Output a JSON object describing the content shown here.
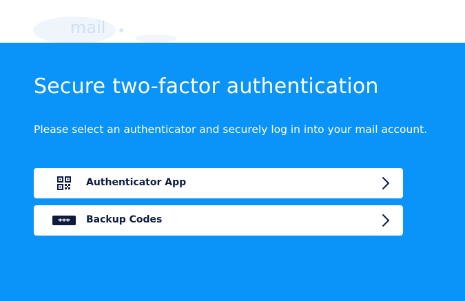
{
  "header": {
    "logo_text": "mail.de"
  },
  "main": {
    "title": "Secure two-factor authentication",
    "subtitle": "Please select an authenticator and securely log in into your mail account.",
    "options": [
      {
        "label": "Authenticator App",
        "icon": "qr-code-icon"
      },
      {
        "label": "Backup Codes",
        "icon": "password-dots-icon"
      }
    ]
  },
  "colors": {
    "background": "#0a93f8",
    "card": "#ffffff",
    "text_dark": "#0d1b3e"
  }
}
